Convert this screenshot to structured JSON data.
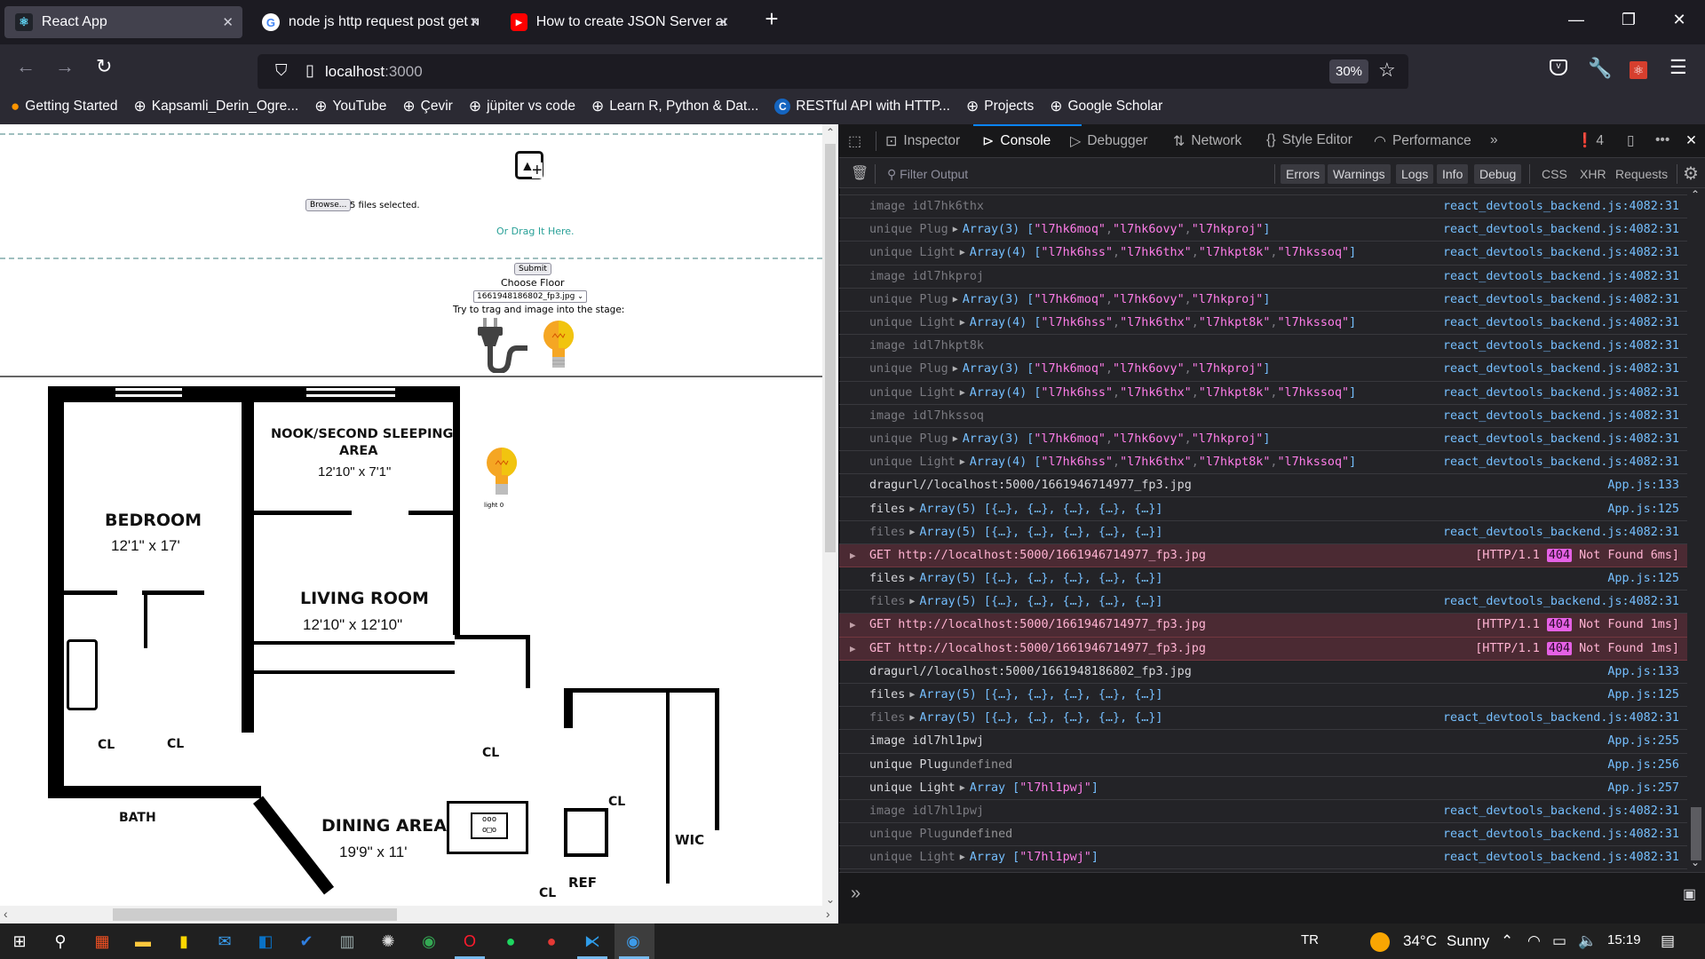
{
  "browser": {
    "tabs": [
      {
        "title": "React App",
        "icon": "react-icon",
        "active": true
      },
      {
        "title": "node js http request post get re",
        "icon": "google-icon",
        "active": false
      },
      {
        "title": "How to create JSON Server and",
        "icon": "youtube-icon",
        "active": false
      }
    ],
    "new_tab_label": "+",
    "window_controls": {
      "minimize": "—",
      "restore": "❐",
      "close": "✕"
    },
    "url_host": "localhost",
    "url_port": ":3000",
    "zoom": "30%",
    "bookmarks": [
      {
        "label": "Getting Started",
        "icon": "firefox-icon"
      },
      {
        "label": "Kapsamli_Derin_Ogre...",
        "icon": "globe-icon"
      },
      {
        "label": "YouTube",
        "icon": "globe-icon"
      },
      {
        "label": "Çevir",
        "icon": "globe-icon"
      },
      {
        "label": "jüpiter vs code",
        "icon": "globe-icon"
      },
      {
        "label": "Learn R, Python & Dat...",
        "icon": "globe-icon"
      },
      {
        "label": "RESTful API with HTTP...",
        "icon": "c-icon"
      },
      {
        "label": "Projects",
        "icon": "globe-icon"
      },
      {
        "label": "Google Scholar",
        "icon": "globe-icon"
      }
    ]
  },
  "page": {
    "browse_button": "Browse...",
    "files_selected": "5 files selected.",
    "drag_text": "Or Drag It Here.",
    "submit_button": "Submit",
    "choose_floor_label": "Choose Floor",
    "floor_select_value": "1661948186802_fp3.jpg",
    "drag_hint": "Try to trag and image into the stage:",
    "light_label": "light 0",
    "floorplan": {
      "rooms": [
        {
          "name": "BEDROOM",
          "dims": "12'1\" x 17'"
        },
        {
          "name": "NOOK/SECOND SLEEPING",
          "name2": "AREA",
          "dims": "12'10\" x 7'1\""
        },
        {
          "name": "LIVING ROOM",
          "dims": "12'10\" x 12'10\""
        },
        {
          "name": "DINING AREA",
          "dims": "19'9\" x 11'"
        },
        {
          "name": "BATH"
        },
        {
          "name": "CL"
        },
        {
          "name": "WIC"
        },
        {
          "name": "REF"
        }
      ]
    }
  },
  "devtools": {
    "tabs": [
      "Inspector",
      "Console",
      "Debugger",
      "Network",
      "Style Editor",
      "Performance"
    ],
    "active_tab": "Console",
    "error_count": "4",
    "filter_placeholder": "Filter Output",
    "filter_buttons": [
      "Errors",
      "Warnings",
      "Logs",
      "Info",
      "Debug"
    ],
    "filter_toggles": [
      "CSS",
      "XHR",
      "Requests"
    ],
    "console_prompt": "»",
    "rows": [
      {
        "type": "dim",
        "key": "image id",
        "text": "l7hk6thx",
        "src": "react_devtools_backend.js:4082:31"
      },
      {
        "type": "dim",
        "key": "unique Plug",
        "arr": "Array(3)",
        "items": [
          "l7hk6moq",
          "l7hk6ovy",
          "l7hkproj"
        ],
        "src": "react_devtools_backend.js:4082:31"
      },
      {
        "type": "dim",
        "key": "unique Light",
        "arr": "Array(4)",
        "items": [
          "l7hk6hss",
          "l7hk6thx",
          "l7hkpt8k",
          "l7hkssoq"
        ],
        "src": "react_devtools_backend.js:4082:31"
      },
      {
        "type": "dim",
        "key": "image id",
        "text": "l7hkproj",
        "src": "react_devtools_backend.js:4082:31"
      },
      {
        "type": "dim",
        "key": "unique Plug",
        "arr": "Array(3)",
        "items": [
          "l7hk6moq",
          "l7hk6ovy",
          "l7hkproj"
        ],
        "src": "react_devtools_backend.js:4082:31"
      },
      {
        "type": "dim",
        "key": "unique Light",
        "arr": "Array(4)",
        "items": [
          "l7hk6hss",
          "l7hk6thx",
          "l7hkpt8k",
          "l7hkssoq"
        ],
        "src": "react_devtools_backend.js:4082:31"
      },
      {
        "type": "dim",
        "key": "image id",
        "text": "l7hkpt8k",
        "src": "react_devtools_backend.js:4082:31"
      },
      {
        "type": "dim",
        "key": "unique Plug",
        "arr": "Array(3)",
        "items": [
          "l7hk6moq",
          "l7hk6ovy",
          "l7hkproj"
        ],
        "src": "react_devtools_backend.js:4082:31"
      },
      {
        "type": "dim",
        "key": "unique Light",
        "arr": "Array(4)",
        "items": [
          "l7hk6hss",
          "l7hk6thx",
          "l7hkpt8k",
          "l7hkssoq"
        ],
        "src": "react_devtools_backend.js:4082:31"
      },
      {
        "type": "dim",
        "key": "image id",
        "text": "l7hkssoq",
        "src": "react_devtools_backend.js:4082:31"
      },
      {
        "type": "dim",
        "key": "unique Plug",
        "arr": "Array(3)",
        "items": [
          "l7hk6moq",
          "l7hk6ovy",
          "l7hkproj"
        ],
        "src": "react_devtools_backend.js:4082:31"
      },
      {
        "type": "dim",
        "key": "unique Light",
        "arr": "Array(4)",
        "items": [
          "l7hk6hss",
          "l7hk6thx",
          "l7hkpt8k",
          "l7hkssoq"
        ],
        "src": "react_devtools_backend.js:4082:31"
      },
      {
        "type": "log",
        "key": "dragurl",
        "text": "//localhost:5000/1661946714977_fp3.jpg",
        "src": "App.js:133"
      },
      {
        "type": "log",
        "key": "files",
        "arr": "Array(5)",
        "objs": 5,
        "src": "App.js:125"
      },
      {
        "type": "dim",
        "key": "files",
        "arr": "Array(5)",
        "objs": 5,
        "src": "react_devtools_backend.js:4082:31"
      },
      {
        "type": "err",
        "text": "GET http://localhost:5000/1661946714977_fp3.jpg",
        "status_pre": "[HTTP/1.1",
        "status": "404",
        "status_post": "Not Found 6ms]"
      },
      {
        "type": "log",
        "key": "files",
        "arr": "Array(5)",
        "objs": 5,
        "src": "App.js:125"
      },
      {
        "type": "dim",
        "key": "files",
        "arr": "Array(5)",
        "objs": 5,
        "src": "react_devtools_backend.js:4082:31"
      },
      {
        "type": "err",
        "text": "GET http://localhost:5000/1661946714977_fp3.jpg",
        "status_pre": "[HTTP/1.1",
        "status": "404",
        "status_post": "Not Found 1ms]"
      },
      {
        "type": "err",
        "text": "GET http://localhost:5000/1661946714977_fp3.jpg",
        "status_pre": "[HTTP/1.1",
        "status": "404",
        "status_post": "Not Found 1ms]"
      },
      {
        "type": "log",
        "key": "dragurl",
        "text": "//localhost:5000/1661948186802_fp3.jpg",
        "src": "App.js:133"
      },
      {
        "type": "log",
        "key": "files",
        "arr": "Array(5)",
        "objs": 5,
        "src": "App.js:125"
      },
      {
        "type": "dim",
        "key": "files",
        "arr": "Array(5)",
        "objs": 5,
        "src": "react_devtools_backend.js:4082:31"
      },
      {
        "type": "log",
        "key": "image id",
        "text": "l7hl1pwj",
        "src": "App.js:255"
      },
      {
        "type": "log",
        "key": "unique Plug",
        "undef": "undefined",
        "src": "App.js:256"
      },
      {
        "type": "log",
        "key": "unique Light",
        "arr": "Array",
        "items": [
          "l7hl1pwj"
        ],
        "src": "App.js:257"
      },
      {
        "type": "dim",
        "key": "image id",
        "text": "l7hl1pwj",
        "src": "react_devtools_backend.js:4082:31"
      },
      {
        "type": "dim",
        "key": "unique Plug",
        "undef": "undefined",
        "src": "react_devtools_backend.js:4082:31"
      },
      {
        "type": "dim",
        "key": "unique Light",
        "arr": "Array",
        "items": [
          "l7hl1pwj"
        ],
        "src": "react_devtools_backend.js:4082:31"
      }
    ]
  },
  "taskbar": {
    "language": "TR",
    "weather_temp": "34°C",
    "weather_text": "Sunny",
    "time": "15:19"
  },
  "colors": {
    "accent": "#0a84ff",
    "error_row_bg": "#4b2a33",
    "status_404": "#e561e5",
    "source_link": "#75bfff",
    "string": "#ff7de9"
  }
}
